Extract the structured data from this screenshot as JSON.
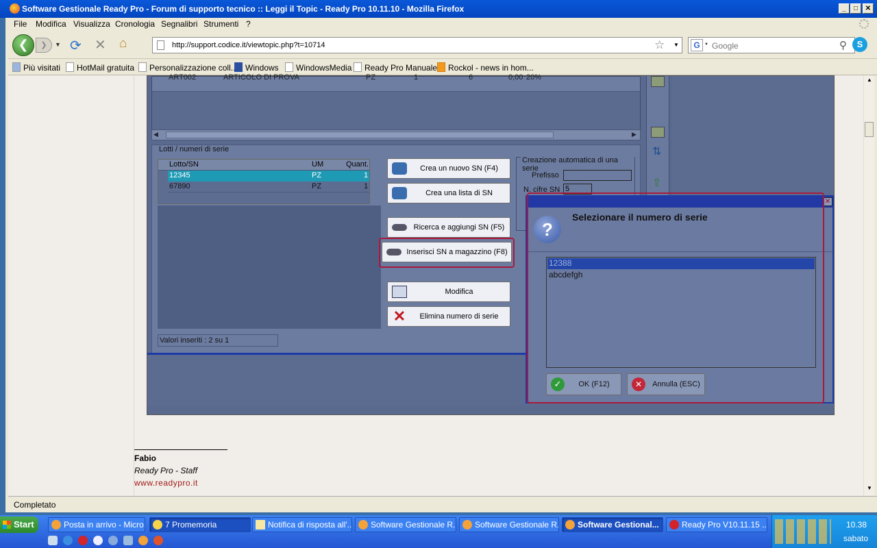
{
  "window": {
    "title": "Software Gestionale Ready Pro - Forum di supporto tecnico :: Leggi il Topic - Ready Pro 10.11.10 - Mozilla Firefox"
  },
  "menu": [
    "File",
    "Modifica",
    "Visualizza",
    "Cronologia",
    "Segnalibri",
    "Strumenti",
    "?"
  ],
  "nav": {
    "url": "http://support.codice.it/viewtopic.php?t=10714",
    "search_placeholder": "Google",
    "search_engine": "G"
  },
  "bookmarks": [
    "Più visitati",
    "HotMail gratuita",
    "Personalizzazione coll...",
    "Windows",
    "WindowsMedia",
    "Ready Pro Manuale",
    "Rockol - news in hom..."
  ],
  "app": {
    "top_row": {
      "code": "ART002",
      "desc": "ARTICOLO DI PROVA",
      "um": "PZ",
      "qty": "1",
      "col5": "6",
      "price": "0,00",
      "vat": "20%"
    },
    "lots_group": "Lotti / numeri di serie",
    "lots_headers": [
      "Lotto/SN",
      "UM",
      "Quant."
    ],
    "lots_rows": [
      {
        "sn": "12345",
        "um": "PZ",
        "qty": "1"
      },
      {
        "sn": "67890",
        "um": "PZ",
        "qty": "1"
      }
    ],
    "buttons": {
      "new_sn": "Crea un nuovo SN (F4)",
      "list_sn": "Crea una lista di SN",
      "search_sn": "Ricerca e aggiungi SN (F5)",
      "insert_sn": "Inserisci SN a magazzino (F8)",
      "modify": "Modifica",
      "delete": "Elimina numero di serie"
    },
    "auto_group": "Creazione automatica di una serie",
    "prefix_label": "Prefisso",
    "digits_label": "N. cifre SN",
    "digits_value": "5",
    "values_inserted": "Valori inseriti : 2 su 1"
  },
  "dialog": {
    "title": "Selezionare il numero di serie",
    "items": [
      "12388",
      "abcdefgh"
    ],
    "ok": "OK (F12)",
    "cancel": "Annulla (ESC)"
  },
  "post": {
    "author": "Fabio",
    "role": "Ready Pro - Staff",
    "site": "www.readypro.it"
  },
  "status": "Completato",
  "taskbar": {
    "start": "Start",
    "items": [
      "Posta in arrivo - Micro...",
      "7 Promemoria",
      "Notifica di risposta all'...",
      "Software Gestionale R...",
      "Software Gestionale R...",
      "Software Gestional...",
      "Ready Pro V10.11.15 ..."
    ],
    "time": "10.38",
    "day": "sabato"
  }
}
